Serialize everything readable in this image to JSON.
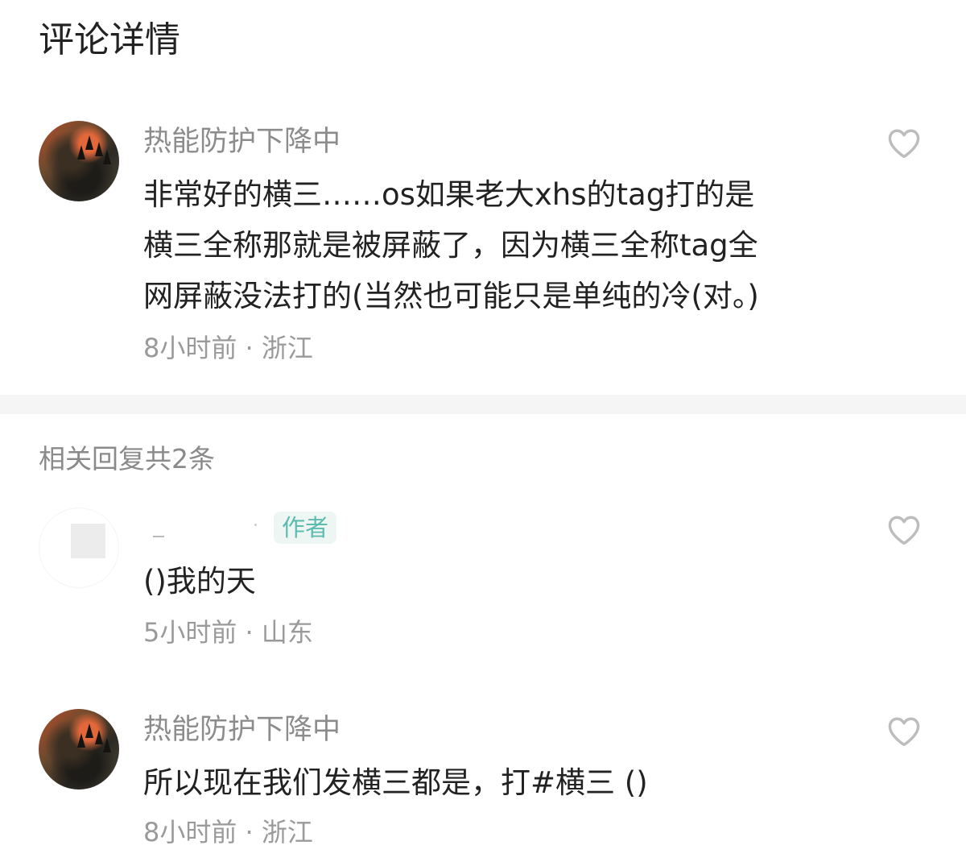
{
  "page": {
    "title": "评论详情"
  },
  "main_comment": {
    "username": "热能防护下降中",
    "text_lines": [
      "非常好的横三……os如果老大xhs的tag打的是",
      "横三全称那就是被屏蔽了，因为横三全称tag全",
      "网屏蔽没法打的(当然也可能只是单纯的冷(对。)"
    ],
    "time": "8小时前",
    "location": "浙江",
    "separator": " · ",
    "avatar_icon": "dragon-avatar"
  },
  "replies": {
    "header": "相关回复共2条",
    "items": [
      {
        "username": "",
        "badge": "作者",
        "text": "()我的天",
        "time": "5小时前",
        "location": "山东",
        "avatar_icon": "blank-avatar"
      },
      {
        "username": "热能防护下降中",
        "badge": "",
        "text": "所以现在我们发横三都是，打#横三 ()",
        "time": "8小时前",
        "location": "浙江",
        "avatar_icon": "dragon-avatar"
      }
    ]
  },
  "icons": {
    "like": "heart-outline-icon"
  },
  "colors": {
    "text_primary": "#222222",
    "text_secondary": "#8c8c8c",
    "badge_text": "#5cbcb0",
    "badge_bg": "#eef6f4",
    "divider": "#f5f5f5",
    "heart_stroke": "#bdbdbd"
  }
}
